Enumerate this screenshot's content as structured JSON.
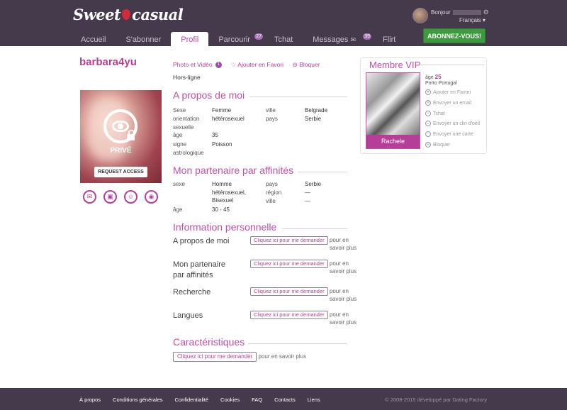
{
  "brand": {
    "logo_left": "Sweet",
    "logo_right": "casual"
  },
  "nav": {
    "items": [
      {
        "label": "Accueil",
        "badge": ""
      },
      {
        "label": "S'abonner",
        "badge": ""
      },
      {
        "label": "Profil",
        "badge": ""
      },
      {
        "label": "Parcourir",
        "badge": "27"
      },
      {
        "label": "Tchat",
        "badge": ""
      },
      {
        "label": "Messages",
        "badge": "39"
      },
      {
        "label": "Flirt",
        "badge": ""
      }
    ]
  },
  "user": {
    "greeting": "Bonjour",
    "language": "Français"
  },
  "cta": {
    "subscribe": "ABONNEZ-VOUS!"
  },
  "profile": {
    "username": "barbara4yu",
    "photo_label": "PRIVÉ",
    "request_access": "REQUEST ACCESS",
    "links": {
      "photos": "Photo et Vidéo",
      "photos_count": "1",
      "favorite": "Ajouter en Favori",
      "block": "Bloquer"
    },
    "status": "Hors-ligne"
  },
  "about": {
    "title": "A propos de moi",
    "left": [
      {
        "label": "Sexe",
        "value": "Femme"
      },
      {
        "label": "orientation sexuelle",
        "value": "hétérosexuel"
      },
      {
        "label": "âge",
        "value": "35"
      },
      {
        "label": "signe astrologique",
        "value": "Poisson"
      }
    ],
    "right": [
      {
        "label": "ville",
        "value": "Belgrade"
      },
      {
        "label": "pays",
        "value": "Serbie"
      }
    ]
  },
  "partner": {
    "title": "Mon partenaire par affinités",
    "sex_label": "sexe",
    "sex_value": "Homme hétérosexuel, Bisexuel",
    "age_label": "âge",
    "age_value": "30 - 45",
    "right": [
      {
        "label": "pays",
        "value": "Serbie"
      },
      {
        "label": "région",
        "value": "—"
      },
      {
        "label": "ville",
        "value": "—"
      }
    ]
  },
  "personal": {
    "title": "Information personnelle",
    "ask_button": "Cliquez ici pour me demander",
    "ask_suffix": "pour en savoir plus",
    "rows": [
      {
        "label": "A propos de moi"
      },
      {
        "label": "Mon partenaire par affinités"
      },
      {
        "label": "Recherche"
      },
      {
        "label": "Langues"
      }
    ]
  },
  "characteristics": {
    "title": "Caractéristiques",
    "ask_button": "Cliquez ici pour me demander",
    "ask_suffix": "pour en savoir plus"
  },
  "vip": {
    "title": "Membre VIP",
    "name": "Rachele",
    "age_label": "âge",
    "age": "25",
    "location": "Porto Portugal",
    "actions": [
      {
        "icon": "heart-icon",
        "label": "Ajouter en Favori"
      },
      {
        "icon": "mail-icon",
        "label": "Envoyer un email"
      },
      {
        "icon": "chat-icon",
        "label": "Tchat"
      },
      {
        "icon": "wink-icon",
        "label": "Envoyer un clin d'oeil"
      },
      {
        "icon": "card-icon",
        "label": "Envoyer une carte"
      },
      {
        "icon": "block-icon",
        "label": "Bloquer"
      }
    ]
  },
  "footer": {
    "links": [
      "À propos",
      "Conditions générales",
      "Confidentialité",
      "Cookies",
      "FAQ",
      "Contacts",
      "Liens"
    ],
    "copyright": "© 2008-2015 développé par Dating Factory"
  },
  "colors": {
    "header_bg": "#45394c",
    "accent": "#b53f98",
    "cta_green": "#3d9a3f"
  }
}
